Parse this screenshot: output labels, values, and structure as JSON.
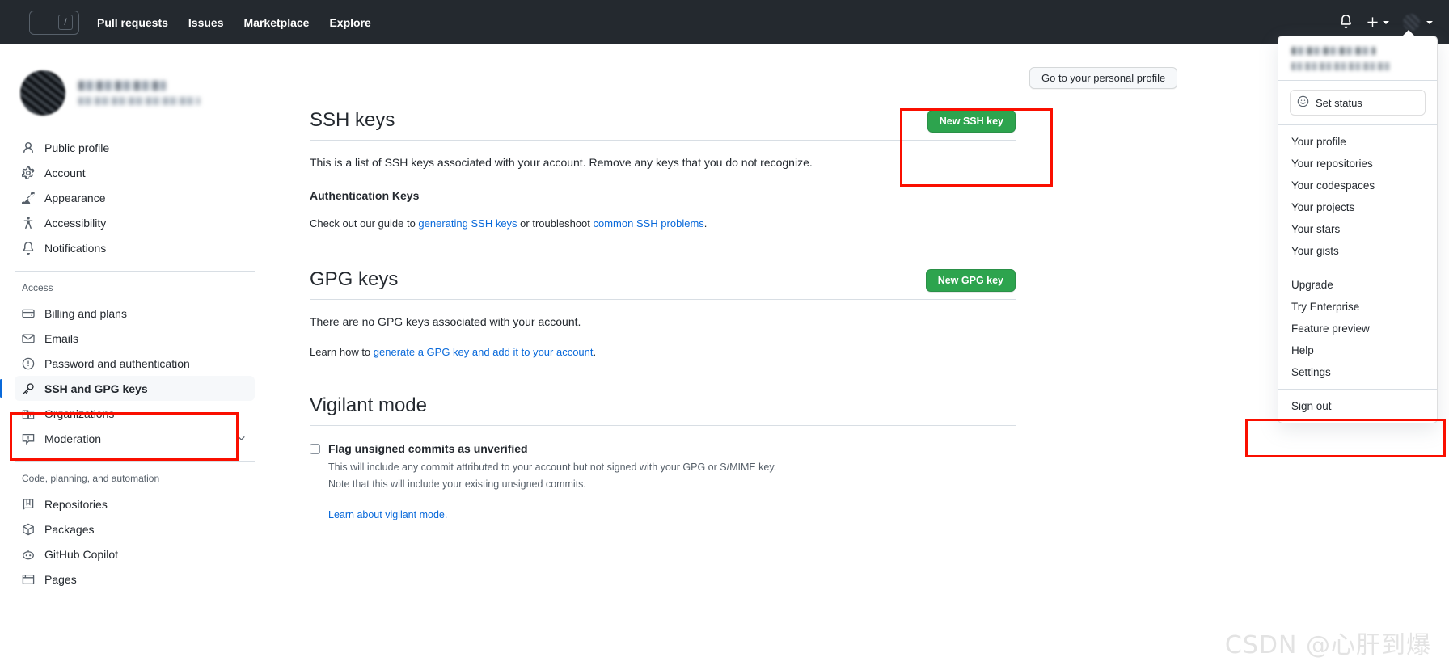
{
  "header": {
    "search_shortcut": "/",
    "nav": [
      {
        "label": "Pull requests"
      },
      {
        "label": "Issues"
      },
      {
        "label": "Marketplace"
      },
      {
        "label": "Explore"
      }
    ],
    "icons": {
      "notifications": "bell-icon",
      "create_new": "plus-icon",
      "avatar": "user-avatar"
    }
  },
  "sidebar": {
    "profile": {
      "name_redacted": "",
      "handle_redacted": ""
    },
    "groups": [
      {
        "heading": "",
        "items": [
          {
            "label": "Public profile",
            "icon": "person-icon",
            "selected": false
          },
          {
            "label": "Account",
            "icon": "gear-icon",
            "selected": false
          },
          {
            "label": "Appearance",
            "icon": "paintbrush-icon",
            "selected": false
          },
          {
            "label": "Accessibility",
            "icon": "accessibility-icon",
            "selected": false
          },
          {
            "label": "Notifications",
            "icon": "bell-icon",
            "selected": false
          }
        ]
      },
      {
        "heading": "Access",
        "items": [
          {
            "label": "Billing and plans",
            "icon": "credit-card-icon",
            "selected": false
          },
          {
            "label": "Emails",
            "icon": "mail-icon",
            "selected": false
          },
          {
            "label": "Password and authentication",
            "icon": "shield-lock-icon",
            "selected": false
          },
          {
            "label": "SSH and GPG keys",
            "icon": "key-icon",
            "selected": true
          },
          {
            "label": "Organizations",
            "icon": "organization-icon",
            "selected": false
          },
          {
            "label": "Moderation",
            "icon": "report-icon",
            "selected": false,
            "chevron": true
          }
        ]
      },
      {
        "heading": "Code, planning, and automation",
        "items": [
          {
            "label": "Repositories",
            "icon": "repo-icon",
            "selected": false
          },
          {
            "label": "Packages",
            "icon": "package-icon",
            "selected": false
          },
          {
            "label": "GitHub Copilot",
            "icon": "copilot-icon",
            "selected": false
          },
          {
            "label": "Pages",
            "icon": "browser-icon",
            "selected": false
          }
        ]
      }
    ]
  },
  "main": {
    "personal_profile_button": "Go to your personal profile",
    "ssh": {
      "title": "SSH keys",
      "new_button": "New SSH key",
      "description": "This is a list of SSH keys associated with your account. Remove any keys that you do not recognize.",
      "auth_heading": "Authentication Keys",
      "guide_prefix": "Check out our guide to ",
      "guide_link1": "generating SSH keys",
      "guide_middle": " or troubleshoot ",
      "guide_link2": "common SSH problems",
      "guide_suffix": "."
    },
    "gpg": {
      "title": "GPG keys",
      "new_button": "New GPG key",
      "description": "There are no GPG keys associated with your account.",
      "learn_prefix": "Learn how to ",
      "learn_link": "generate a GPG key and add it to your account",
      "learn_suffix": "."
    },
    "vigilant": {
      "title": "Vigilant mode",
      "checkbox_label": "Flag unsigned commits as unverified",
      "note_line1": "This will include any commit attributed to your account but not signed with your GPG or S/MIME key.",
      "note_line2": "Note that this will include your existing unsigned commits.",
      "learn_link": "Learn about vigilant mode."
    }
  },
  "user_menu": {
    "set_status": "Set status",
    "group1": [
      {
        "label": "Your profile"
      },
      {
        "label": "Your repositories"
      },
      {
        "label": "Your codespaces"
      },
      {
        "label": "Your projects"
      },
      {
        "label": "Your stars"
      },
      {
        "label": "Your gists"
      }
    ],
    "group2": [
      {
        "label": "Upgrade"
      },
      {
        "label": "Try Enterprise"
      },
      {
        "label": "Feature preview"
      },
      {
        "label": "Help"
      },
      {
        "label": "Settings",
        "highlighted": true
      }
    ],
    "group3": [
      {
        "label": "Sign out"
      }
    ]
  },
  "annotations": {
    "color": "#fa0f00",
    "boxes": [
      {
        "target": "New SSH key"
      },
      {
        "target": "SSH and GPG keys"
      },
      {
        "target": "Settings"
      }
    ]
  },
  "watermark": "CSDN @心肝到爆"
}
